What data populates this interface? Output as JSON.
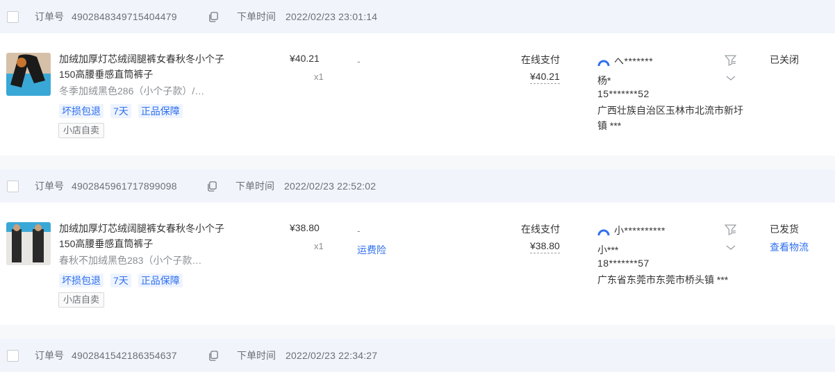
{
  "orders": [
    {
      "order_no_label": "订单号",
      "order_no": "4902848349715404479",
      "time_label": "下单时间",
      "time": "2022/02/23 23:01:14",
      "title": "加绒加厚灯芯绒阔腿裤女春秋冬小个子150高腰垂感直筒裤子",
      "sku": "冬季加绒黑色286（小个子款）/…",
      "tags": [
        "坏损包退",
        "7天",
        "正品保障"
      ],
      "shop_badge": "小店自卖",
      "price": "¥40.21",
      "qty": "x1",
      "dash": "-",
      "insurance": "",
      "pay_method": "在线支付",
      "pay_amount": "¥40.21",
      "buyer_nick": "へ*******",
      "receiver_name": "杨*",
      "receiver_phone": "15*******52",
      "receiver_addr": "广西壮族自治区玉林市北流市新圩镇 ***",
      "status": "已关闭",
      "logistics": ""
    },
    {
      "order_no_label": "订单号",
      "order_no": "4902845961717899098",
      "time_label": "下单时间",
      "time": "2022/02/23 22:52:02",
      "title": "加绒加厚灯芯绒阔腿裤女春秋冬小个子150高腰垂感直筒裤子",
      "sku": "春秋不加绒黑色283（小个子款…",
      "tags": [
        "坏损包退",
        "7天",
        "正品保障"
      ],
      "shop_badge": "小店自卖",
      "price": "¥38.80",
      "qty": "x1",
      "dash": "-",
      "insurance": "运费险",
      "pay_method": "在线支付",
      "pay_amount": "¥38.80",
      "buyer_nick": "小**********",
      "receiver_name": "小***",
      "receiver_phone": "18*******57",
      "receiver_addr": "广东省东莞市东莞市桥头镇 ***",
      "status": "已发货",
      "logistics": "查看物流"
    },
    {
      "order_no_label": "订单号",
      "order_no": "4902841542186354637",
      "time_label": "下单时间",
      "time": "2022/02/23 22:34:27"
    }
  ],
  "colors": {
    "header_bg": "#f1f5fb",
    "link_blue": "#2f6fed",
    "muted": "#6b7075"
  }
}
